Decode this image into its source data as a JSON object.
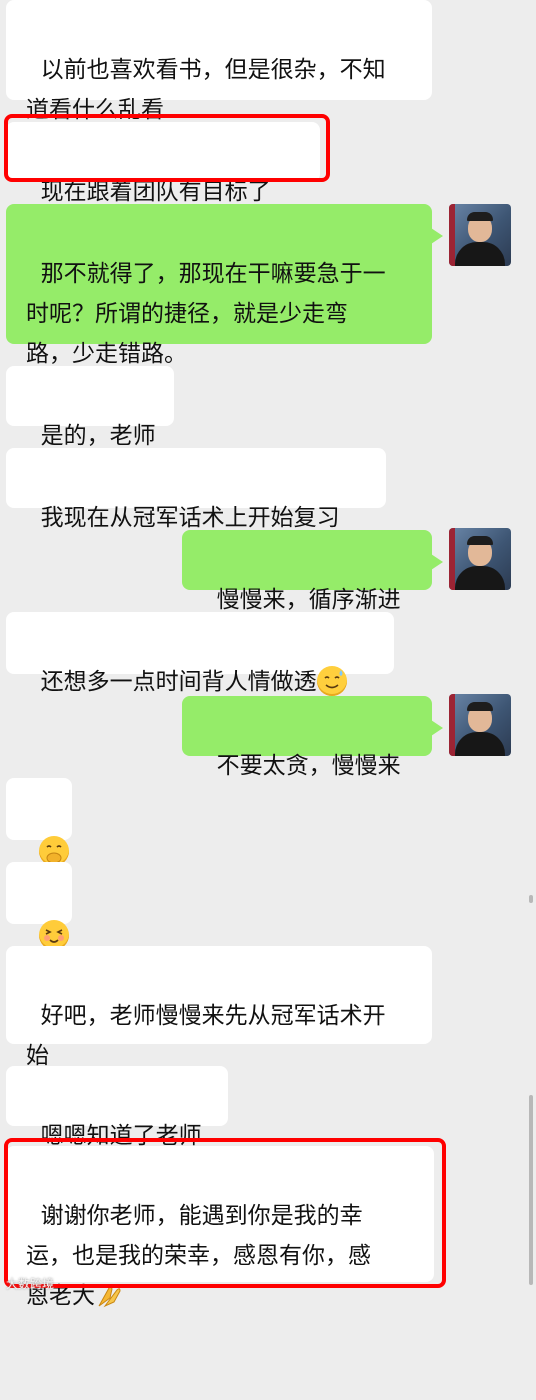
{
  "messages": [
    {
      "side": "left",
      "text": "以前也喜欢看书，但是很杂，不知\n道看什么乱看"
    },
    {
      "side": "left",
      "text": "现在跟着团队有目标了"
    },
    {
      "side": "right",
      "text": "那不就得了，那现在干嘛要急于一\n时呢？所谓的捷径，就是少走弯\n路，少走错路。"
    },
    {
      "side": "left",
      "text": "是的，老师"
    },
    {
      "side": "left",
      "text": "我现在从冠军话术上开始复习"
    },
    {
      "side": "right",
      "text": "慢慢来，循序渐进"
    },
    {
      "side": "left",
      "text": "还想多一点时间背人情做透",
      "emoji": "sweat-smile-emoji"
    },
    {
      "side": "right",
      "text": "不要太贪，慢慢来"
    },
    {
      "side": "left",
      "text": "",
      "emoji": "thinking-hand-emoji"
    },
    {
      "side": "left",
      "text": "",
      "emoji": "shy-smile-emoji"
    },
    {
      "side": "left",
      "text": "好吧，老师慢慢来先从冠军话术开\n始"
    },
    {
      "side": "left",
      "text": "嗯嗯知道了老师"
    },
    {
      "side": "left",
      "text": "谢谢你老师，能遇到你是我的幸\n运，也是我的荣幸，感恩有你，感\n恩老大",
      "emoji": "praying-hands-emoji"
    }
  ],
  "highlight_color": "#ff0000",
  "bubble_colors": {
    "incoming": "#ffffff",
    "outgoing": "#95ec69"
  },
  "watermark": "大数跨境"
}
